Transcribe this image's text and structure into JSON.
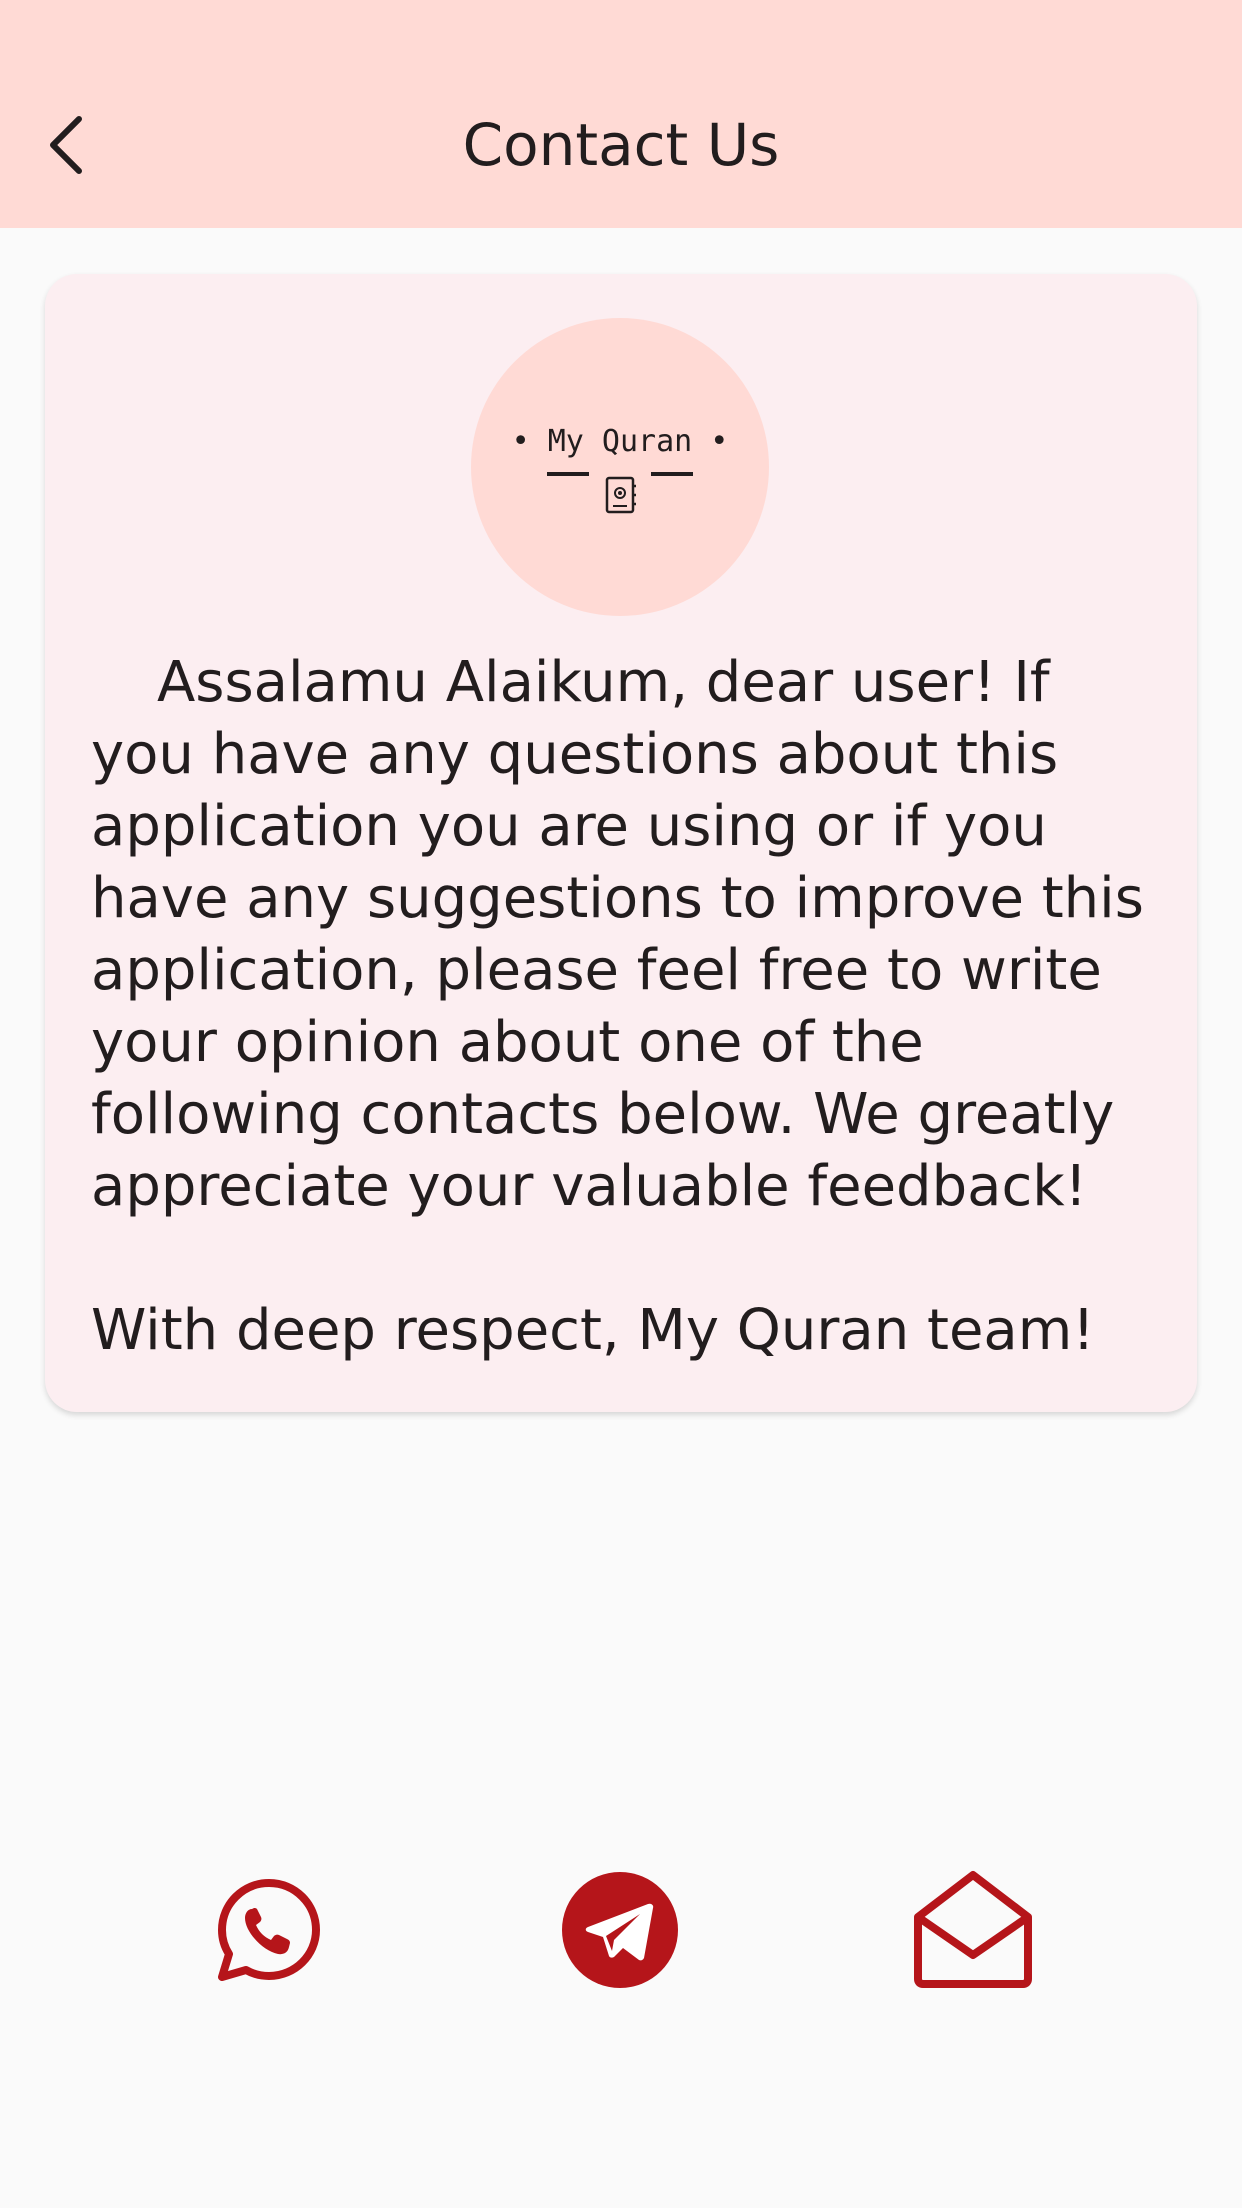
{
  "app_bar": {
    "title": "Contact Us",
    "back_icon": "chevron-left-icon"
  },
  "card": {
    "logo": {
      "text": "• My Quran •",
      "icon": "address-book-icon"
    },
    "message": "Assalamu Alaikum, dear user! If you have any questions about this application you are using or if you have any suggestions to improve this application, please feel free to write your opinion about one of the following contacts below. We greatly appreciate your valuable feedback!",
    "signature": "With deep respect, My Quran team!"
  },
  "contacts": [
    {
      "icon": "whatsapp-icon"
    },
    {
      "icon": "telegram-icon"
    },
    {
      "icon": "email-icon"
    }
  ],
  "colors": {
    "app_bar_bg": "#FFDAD5",
    "card_bg": "#FCEEF1",
    "page_bg": "#FAFAFA",
    "accent": "#B5151A",
    "text": "#221D1E"
  }
}
